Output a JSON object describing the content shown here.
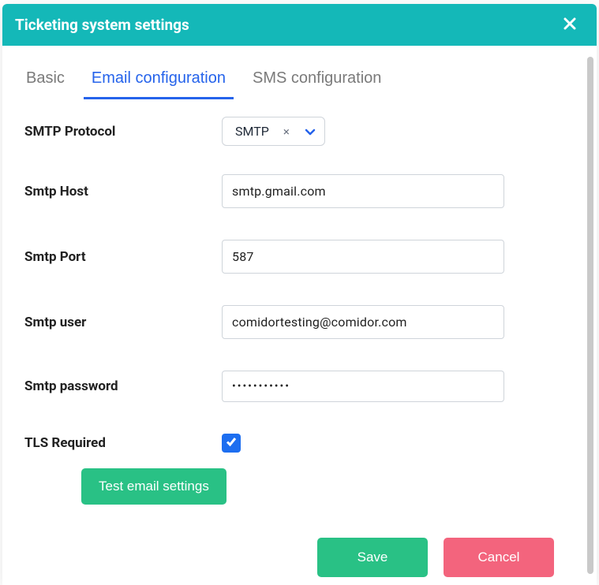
{
  "modal": {
    "title": "Ticketing system settings"
  },
  "tabs": {
    "basic": "Basic",
    "email": "Email configuration",
    "sms": "SMS configuration"
  },
  "form": {
    "protocol_label": "SMTP Protocol",
    "protocol_value": "SMTP",
    "host_label": "Smtp Host",
    "host_value": "smtp.gmail.com",
    "port_label": "Smtp Port",
    "port_value": "587",
    "user_label": "Smtp user",
    "user_value": "comidortesting@comidor.com",
    "password_label": "Smtp password",
    "password_value": "•••••••••••",
    "tls_label": "TLS Required",
    "tls_checked": true,
    "test_button": "Test email settings"
  },
  "footer": {
    "save": "Save",
    "cancel": "Cancel"
  }
}
